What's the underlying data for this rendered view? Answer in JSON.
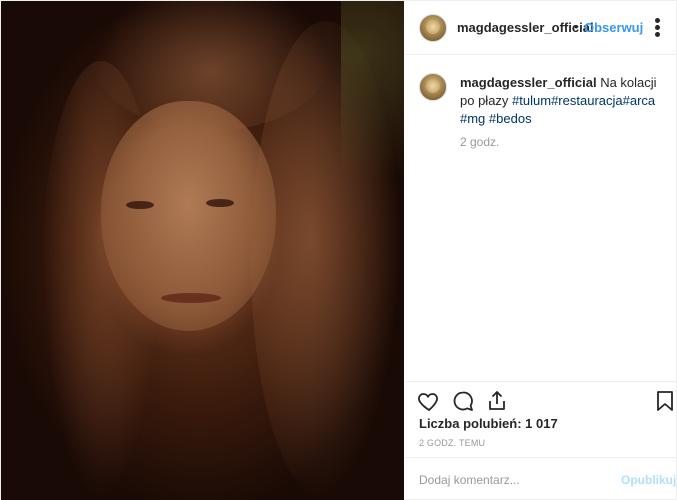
{
  "post": {
    "username": "magdagessler_official",
    "follow_separator": "•",
    "follow_label": "Obserwuj",
    "caption": {
      "username": "magdagessler_official",
      "text": "Na kolacji po płazy",
      "hashtags": [
        "#tulum",
        "#restauracja",
        "#arca",
        "#mg",
        "#bedos"
      ]
    },
    "comment_time": "2 godz.",
    "likes_label": "Liczba polubień: 1 017",
    "posted_ago": "2 GODZ. TEMU",
    "comment_input": {
      "placeholder": "Dodaj komentarz...",
      "value": ""
    },
    "publish_label": "Opublikuj"
  },
  "icons": {
    "like": "heart-icon",
    "comment": "comment-bubble-icon",
    "share": "share-icon",
    "save": "bookmark-icon",
    "more": "more-options-icon"
  },
  "colors": {
    "link_blue": "#3897f0",
    "hashtag": "#003569",
    "muted": "#999999",
    "publish_disabled": "#b2dffc"
  }
}
